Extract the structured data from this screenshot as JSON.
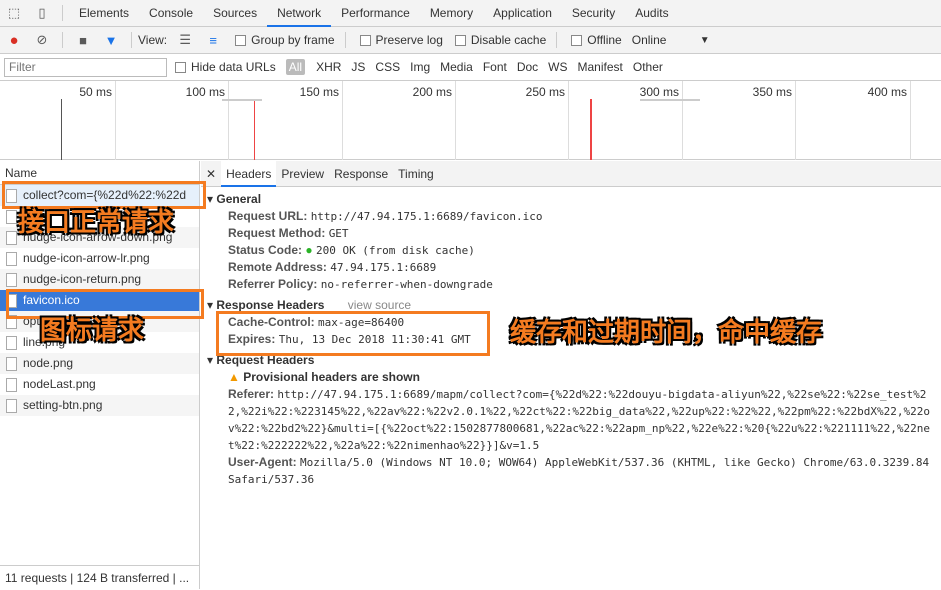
{
  "tabs": [
    "Elements",
    "Console",
    "Sources",
    "Network",
    "Performance",
    "Memory",
    "Application",
    "Security",
    "Audits"
  ],
  "toolbar": {
    "view": "View:",
    "group_by_frame": "Group by frame",
    "preserve_log": "Preserve log",
    "disable_cache": "Disable cache",
    "offline": "Offline",
    "throttle": "Online"
  },
  "filter": {
    "placeholder": "Filter",
    "hide_data_urls": "Hide data URLs",
    "types": [
      "All",
      "XHR",
      "JS",
      "CSS",
      "Img",
      "Media",
      "Font",
      "Doc",
      "WS",
      "Manifest",
      "Other"
    ]
  },
  "timeline": [
    "50 ms",
    "100 ms",
    "150 ms",
    "200 ms",
    "250 ms",
    "300 ms",
    "350 ms",
    "400 ms"
  ],
  "list": {
    "header": "Name",
    "items": [
      "collect?com={%22d%22:%22d",
      "Ping",
      "nudge-icon-arrow-down.png",
      "nudge-icon-arrow-lr.png",
      "nudge-icon-return.png",
      "favicon.ico",
      "options.png",
      "line.png",
      "node.png",
      "nodeLast.png",
      "setting-btn.png"
    ],
    "footer": "11 requests | 124 B transferred | ..."
  },
  "detail": {
    "tabs": [
      "Headers",
      "Preview",
      "Response",
      "Timing"
    ],
    "general": {
      "title": "General",
      "rows": [
        [
          "Request URL:",
          "http://47.94.175.1:6689/favicon.ico"
        ],
        [
          "Request Method:",
          "GET"
        ],
        [
          "Status Code:",
          "200 OK (from disk cache)"
        ],
        [
          "Remote Address:",
          "47.94.175.1:6689"
        ],
        [
          "Referrer Policy:",
          "no-referrer-when-downgrade"
        ]
      ]
    },
    "response": {
      "title": "Response Headers",
      "view_source": "view source",
      "rows": [
        [
          "Cache-Control:",
          "max-age=86400"
        ],
        [
          "Expires:",
          "Thu, 13 Dec 2018 11:30:41 GMT"
        ]
      ]
    },
    "request": {
      "title": "Request Headers",
      "warning": "Provisional headers are shown",
      "rows": [
        [
          "Referer:",
          "http://47.94.175.1:6689/mapm/collect?com={%22d%22:%22douyu-bigdata-aliyun%22,%22se%22:%22se_test%22,%22i%22:%223145%22,%22av%22:%22v2.0.1%22,%22ct%22:%22big_data%22,%22up%22:%22%22,%22pm%22:%22bdX%22,%22ov%22:%22bd2%22}&multi=[{%22oct%22:1502877800681,%22ac%22:%22apm_np%22,%22e%22:%20{%22u%22:%221111%22,%22net%22:%222222%22,%22a%22:%22nimenhao%22}}]&v=1.5"
        ],
        [
          "User-Agent:",
          "Mozilla/5.0 (Windows NT 10.0; WOW64) AppleWebKit/537.36 (KHTML, like Gecko) Chrome/63.0.3239.84 Safari/537.36"
        ]
      ]
    }
  },
  "annotations": [
    "接口正常请求",
    "图标请求",
    "缓存和过期时间，命中缓存"
  ],
  "colors": {
    "annotation": "#f47b20",
    "selected": "#3879d9",
    "status_ok": "#2ab327"
  }
}
